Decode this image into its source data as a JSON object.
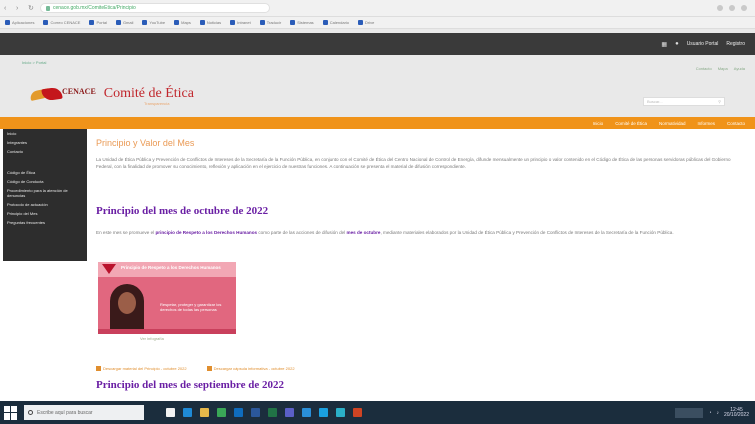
{
  "browser": {
    "url": "cenace.gob.mx/ComiteEtica/Principio",
    "bookmarks": [
      "Aplicaciones",
      "Correo CENACE",
      "Portal",
      "Gmail",
      "YouTube",
      "Maps",
      "Noticias",
      "Intranet",
      "Traducir",
      "Sistemas",
      "Calendario",
      "Drive"
    ]
  },
  "gobbar": {
    "user_label": "Usuario Portal",
    "account_label": "Registro"
  },
  "breadcrumb": "Inicio > Portal",
  "toplinks": [
    "Contacto",
    "Mapa",
    "Ayuda"
  ],
  "header": {
    "logo_text": "CENACE",
    "site_title": "Comité de Ética",
    "site_subtitle": "Transparencia",
    "search_placeholder": "Buscar..."
  },
  "mainnav": [
    "Inicio",
    "Comité de Ética",
    "Normatividad",
    "Informes",
    "Contacto"
  ],
  "sidebar": {
    "top": [
      "Inicio",
      "Integrantes",
      "Contacto"
    ],
    "bottom": [
      "Código de Ética",
      "Código de Conducta",
      "Procedimiento para la atención de denuncias",
      "Protocolo de actuación",
      "Principio del Mes",
      "Preguntas frecuentes"
    ]
  },
  "content": {
    "page_title": "Principio y Valor del Mes",
    "intro": "La Unidad de Ética Pública y Prevención de Conflictos de Intereses de la Secretaría de la Función Pública, en conjunto con el Comité de Ética del Centro Nacional de Control de Energía, difunde mensualmente un principio o valor contenido en el Código de Ética de las personas servidoras públicas del Gobierno Federal, con la finalidad de promover su conocimiento, reflexión y aplicación en el ejercicio de nuestras funciones. A continuación se presenta el material de difusión correspondiente.",
    "section1_title": "Principio del mes de octubre de 2022",
    "section1_pre": "En este mes se promueve el ",
    "section1_bold": "principio de Respeto a los Derechos Humanos",
    "section1_mid": " como parte de las acciones de difusión del ",
    "section1_bold2": "mes de octubre",
    "section1_post": ", mediante materiales elaborados por la Unidad de Ética Pública y Prevención de Conflictos de Intereses de la Secretaría de la Función Pública.",
    "poster_title": "Principio de Respeto a los Derechos Humanos",
    "poster_caption": "Respetar, proteger y garantizar los derechos de todas las personas",
    "poster_image_caption": "Ver infografía",
    "link1": "Descargar material del Principio - octubre 2022",
    "link2": "Descargar cápsula informativa - octubre 2022",
    "section2_title": "Principio del mes de septiembre de 2022"
  },
  "taskbar": {
    "search_placeholder": "Escribe aquí para buscar",
    "time": "12:45",
    "date": "20/10/2022",
    "apps": [
      {
        "name": "task-view",
        "color": "#f2f2f2"
      },
      {
        "name": "edge",
        "color": "#1f8ad6"
      },
      {
        "name": "explorer",
        "color": "#e6b84a"
      },
      {
        "name": "chrome",
        "color": "#3aa757"
      },
      {
        "name": "outlook",
        "color": "#0f6cbd"
      },
      {
        "name": "word",
        "color": "#2b579a"
      },
      {
        "name": "excel",
        "color": "#217346"
      },
      {
        "name": "teams",
        "color": "#5b5fc7"
      },
      {
        "name": "store",
        "color": "#2a8fd8"
      },
      {
        "name": "mail",
        "color": "#1aa0e0"
      },
      {
        "name": "photos",
        "color": "#2bb0c8"
      },
      {
        "name": "powerpoint",
        "color": "#d04423"
      }
    ]
  }
}
